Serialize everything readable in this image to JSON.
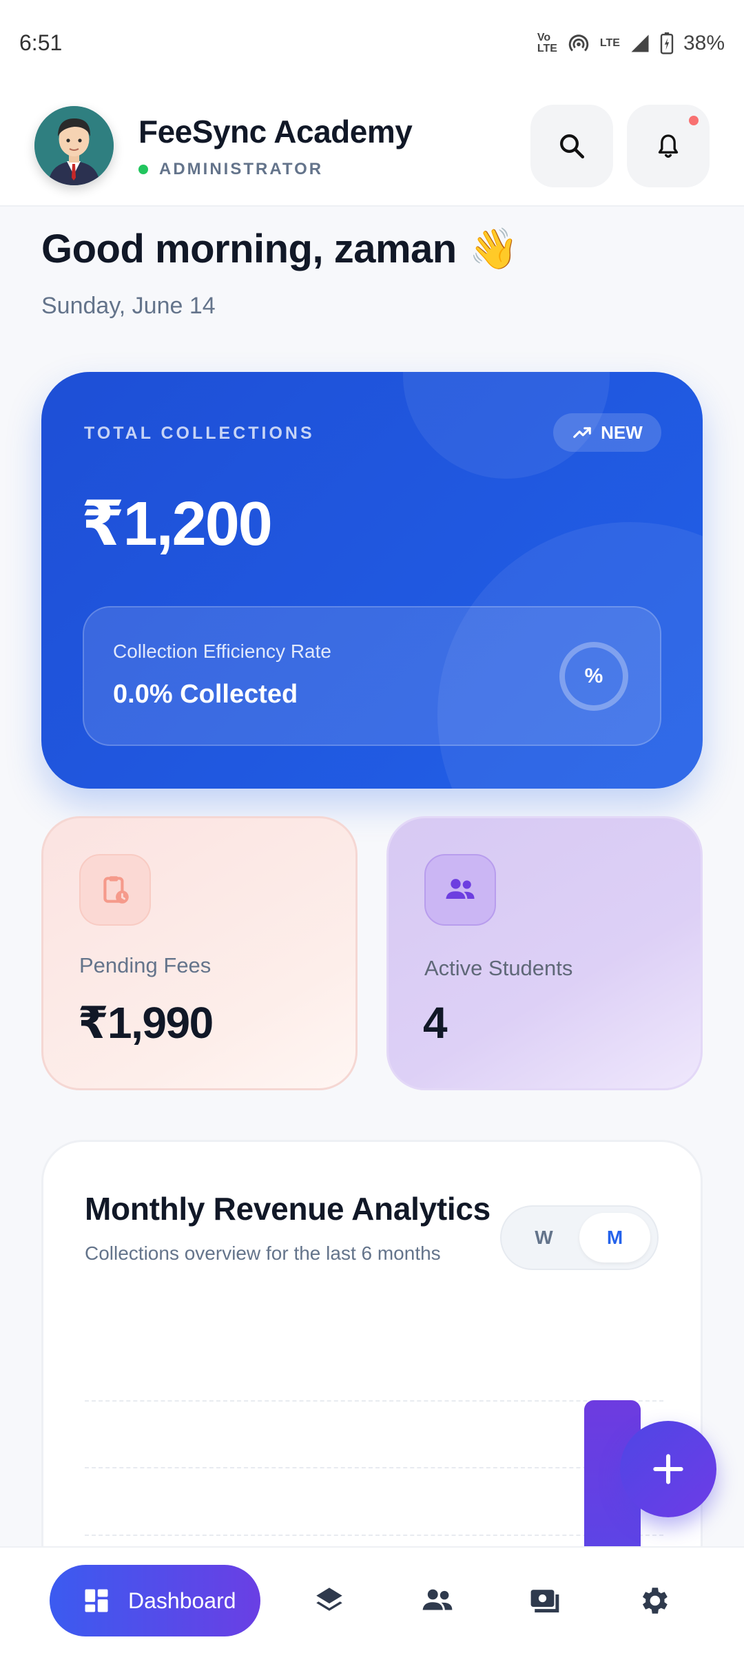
{
  "status_bar": {
    "time": "6:51",
    "battery": "38%",
    "network": "LTE",
    "volte": "Vo LTE"
  },
  "header": {
    "app_title": "FeeSync Academy",
    "role": "ADMINISTRATOR",
    "role_status_color": "#22c55e",
    "icons": [
      "search-icon",
      "bell-icon"
    ]
  },
  "greeting": {
    "text": "Good morning, zaman",
    "emoji": "👋",
    "date": "Sunday, June 14"
  },
  "total_collections": {
    "label": "TOTAL COLLECTIONS",
    "badge": "NEW",
    "amount": "₹1,200",
    "efficiency_label": "Collection Efficiency Rate",
    "efficiency_value": "0.0% Collected",
    "efficiency_icon": "%",
    "accent_color": "#2563eb"
  },
  "stats": {
    "pending": {
      "label": "Pending Fees",
      "value": "₹1,990",
      "icon": "clipboard-clock-icon"
    },
    "active": {
      "label": "Active Students",
      "value": "4",
      "icon": "people-icon"
    }
  },
  "analytics": {
    "title": "Monthly Revenue Analytics",
    "subtitle": "Collections overview for the last 6 months",
    "toggle": [
      "W",
      "M"
    ],
    "toggle_selected": "M"
  },
  "bottom_nav": {
    "active_label": "Dashboard",
    "items": [
      "dashboard-icon",
      "layers-icon",
      "people-icon",
      "payments-icon",
      "settings-icon"
    ]
  }
}
